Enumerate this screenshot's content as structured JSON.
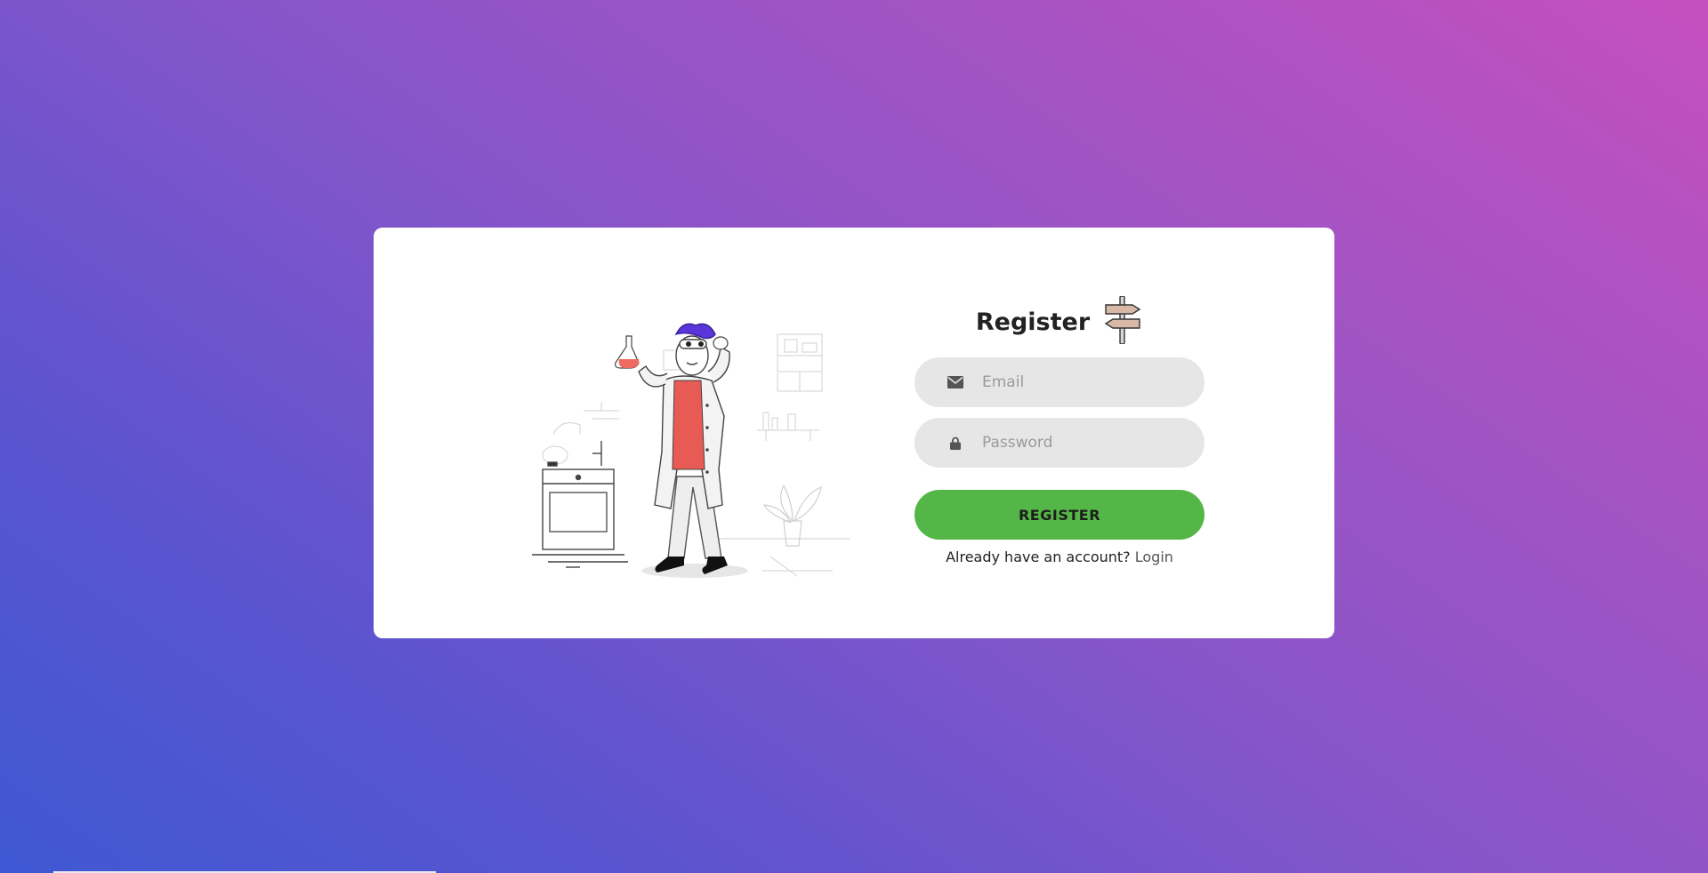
{
  "page": {
    "background_colors": [
      "#3f58d3",
      "#8755c9",
      "#c54fbf"
    ]
  },
  "form": {
    "title": "Register",
    "title_icon": "signpost-icon",
    "email": {
      "placeholder": "Email",
      "value": "",
      "icon": "envelope-icon"
    },
    "password": {
      "placeholder": "Password",
      "value": "",
      "icon": "lock-icon"
    },
    "submit_label": "REGISTER",
    "switch_prompt": "Already have an account?",
    "switch_link": "Login"
  },
  "illustration": {
    "subject": "scientist-holding-flask-illustration"
  },
  "colors": {
    "button": "#54b646",
    "field_background": "#e6e6e6",
    "card_background": "#ffffff"
  }
}
